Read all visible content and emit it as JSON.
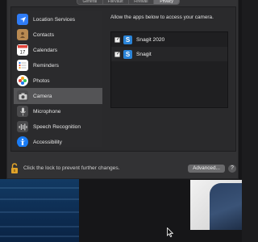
{
  "toolbar": {
    "segments": [
      "General",
      "FileVault",
      "Firewall",
      "Privacy"
    ],
    "active_index": 3
  },
  "sidebar": {
    "items": [
      {
        "label": "Location Services",
        "icon": "location-arrow-icon",
        "color": "#2f7cf6"
      },
      {
        "label": "Contacts",
        "icon": "contacts-book-icon",
        "color": "#b98a52"
      },
      {
        "label": "Calendars",
        "icon": "calendar-icon",
        "color": "#ffffff"
      },
      {
        "label": "Reminders",
        "icon": "reminders-list-icon",
        "color": "#ffffff"
      },
      {
        "label": "Photos",
        "icon": "photos-flower-icon",
        "color": "#f5a623"
      },
      {
        "label": "Camera",
        "icon": "camera-icon",
        "color": "#4a4a4c"
      },
      {
        "label": "Microphone",
        "icon": "microphone-icon",
        "color": "#4a4a4c"
      },
      {
        "label": "Speech Recognition",
        "icon": "waveform-icon",
        "color": "#4a4a4c"
      },
      {
        "label": "Accessibility",
        "icon": "accessibility-person-icon",
        "color": "#1a7cf5"
      }
    ],
    "selected_index": 5
  },
  "content": {
    "title": "Allow the apps below to access your camera.",
    "apps": [
      {
        "name": "Snagit 2020",
        "checked": true,
        "icon": "snagit-icon"
      },
      {
        "name": "Snagit",
        "checked": true,
        "icon": "snagit-icon"
      }
    ]
  },
  "footer": {
    "lock_text": "Click the lock to prevent further changes.",
    "advanced_label": "Advanced...",
    "help_label": "?"
  },
  "colors": {
    "accent": "#2a84d8",
    "lock": "#e0a32a"
  }
}
